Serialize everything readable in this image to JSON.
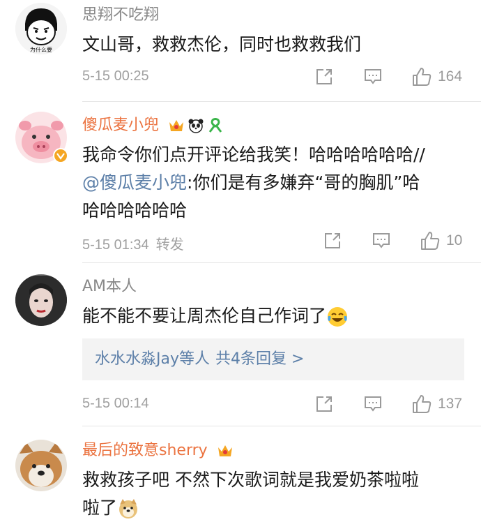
{
  "comments": [
    {
      "username": "思翔不吃翔",
      "avatar_caption": "为什么要",
      "text": "文山哥，救救杰伦，同时也救救我们",
      "time": "5-15 00:25",
      "likes": "164"
    },
    {
      "username": "傻瓜麦小兜",
      "text_line1": "我命令你们点开评论给我笑！哈哈哈哈哈哈//",
      "mention": "@傻瓜麦小兜",
      "text_line2_rest": ":你们是有多嫌弃“哥的胸肌”哈",
      "text_line3": "哈哈哈哈哈哈",
      "time": "5-15 01:34",
      "forward_label": "转发",
      "likes": "10"
    },
    {
      "username": "AM本人",
      "text": "能不能不要让周杰伦自己作词了",
      "reply_users": "水水水淼Jay等人",
      "reply_count": "共4条回复 >",
      "time": "5-15 00:14",
      "likes": "137"
    },
    {
      "username": "最后的致意sherry",
      "text_line1": "救救孩子吧  不然下次歌词就是我爱奶茶啦啦",
      "text_line2": "啦了"
    }
  ],
  "icons": {
    "share": "share-icon",
    "comment": "comment-icon",
    "like": "thumbs-up-icon",
    "vip": "crown-icon",
    "verified": "verified-badge-icon"
  },
  "colors": {
    "vip_username": "#eb7340",
    "link": "#5c7fa8",
    "meta": "#a0a0a0"
  }
}
